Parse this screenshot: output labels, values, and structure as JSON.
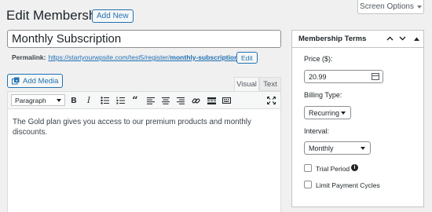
{
  "header": {
    "title": "Edit Membership",
    "add_new_label": "Add New",
    "screen_options_label": "Screen Options"
  },
  "post": {
    "title_value": "Monthly Subscription",
    "permalink_label": "Permalink:",
    "permalink_base": "https://startyourwpsite.com/test5/register/",
    "permalink_slug": "monthly-subscription",
    "permalink_tail": "/",
    "edit_label": "Edit"
  },
  "editor": {
    "add_media_label": "Add Media",
    "tab_visual": "Visual",
    "tab_text": "Text",
    "format_value": "Paragraph",
    "content": "The Gold plan gives you access to our premium products and monthly discounts."
  },
  "terms_panel": {
    "title": "Membership Terms",
    "price_label": "Price ($):",
    "price_value": "20.99",
    "billing_type_label": "Billing Type:",
    "billing_type_value": "Recurring",
    "interval_label": "Interval:",
    "interval_value": "Monthly",
    "trial_period_label": "Trial Period",
    "trial_period_checked": false,
    "limit_cycles_label": "Limit Payment Cycles",
    "limit_cycles_checked": false
  },
  "colors": {
    "accent": "#2271b1",
    "background": "#f0f0f1",
    "panel_border": "#c3c4c7"
  }
}
